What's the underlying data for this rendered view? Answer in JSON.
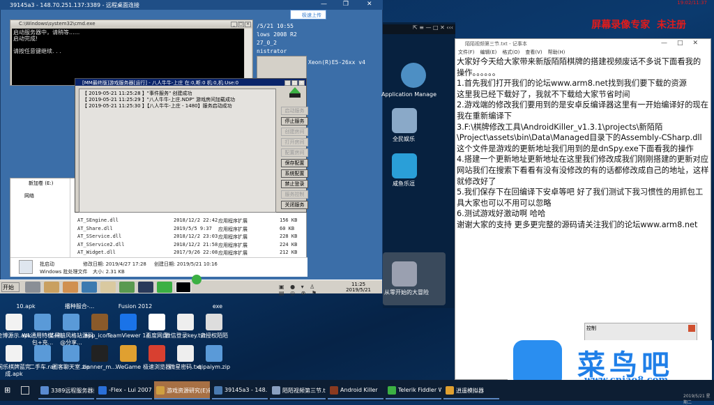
{
  "remote": {
    "title": "39145a3 - 148.70.251.137:3389 - 远程桌面连接",
    "upload": "极速上传",
    "sysinfo": [
      "/5/21 10:55",
      "lows 2008 R2",
      "27_0_2",
      "nistrator"
    ],
    "cpu": "Xeon(R)E5-26xx v4"
  },
  "cmd": {
    "title": "C:\\Windows\\system32\\cmd.exe",
    "lines": [
      "启动服务器中，请稍等......",
      "启动完成!",
      "",
      "请按任意键继续. . ."
    ]
  },
  "server": {
    "title": "[MM最终版]游戏服务器[运行] - 八人牛牛-上庄      在:0,断:0      机:0,机:Use:0",
    "log": [
      "【 2019-05-21 11:25:28 】\"事件服务\" 创建成功",
      "【 2019-05-21 11:25:29 】\"八人牛牛-上庄.NDP\" 游戏房间加载成功",
      "【 2019-05-21 11:25:30 】【八人牛牛-上庄 - 1480】服务启动成功"
    ],
    "buttons": [
      {
        "label": "启动服务",
        "enabled": false
      },
      {
        "label": "停止服务",
        "enabled": true
      },
      {
        "label": "创建房间",
        "enabled": false
      },
      {
        "label": "打开房间",
        "enabled": false
      },
      {
        "label": "配置房间",
        "enabled": false
      },
      {
        "label": "保存配置",
        "enabled": true
      },
      {
        "label": "系统配置",
        "enabled": true
      },
      {
        "label": "禁止登录",
        "enabled": true
      },
      {
        "label": "服务控制",
        "enabled": false
      },
      {
        "label": "关闭服务",
        "enabled": true
      }
    ]
  },
  "explorer": {
    "drive": "新加卷 (E:)",
    "network": "网络",
    "files": [
      {
        "name": "AT_SEngine.dll",
        "date": "2018/12/2 22:42",
        "type": "应用程序扩展",
        "size": "156 KB"
      },
      {
        "name": "AT_Share.dll",
        "date": "2019/5/5 9:37",
        "type": "应用程序扩展",
        "size": "60 KB"
      },
      {
        "name": "AT_SService.dll",
        "date": "2018/12/2 23:03",
        "type": "应用程序扩展",
        "size": "228 KB"
      },
      {
        "name": "AT_SService2.dll",
        "date": "2018/12/2 21:58",
        "type": "应用程序扩展",
        "size": "224 KB"
      },
      {
        "name": "AT_Widget.dll",
        "date": "2017/9/26 22:08",
        "type": "应用程序扩展",
        "size": "212 KB"
      }
    ],
    "detail": {
      "name": "批启动",
      "kind": "Windows 批处理文件",
      "modified": "修改日期: 2019/4/27 17:28",
      "created": "创建日期: 2019/5/21 10:16",
      "size": "大小: 2.31 KB"
    }
  },
  "inner_taskbar": {
    "start": "开始",
    "time": "11:25",
    "date": "2019/5/21"
  },
  "emulator": {
    "apps": [
      "Application Manage",
      "全民娱乐",
      "咸鱼乐逗",
      "从零开始的大冒险"
    ]
  },
  "recorder": {
    "watermark": "屏幕录像专家",
    "unregistered": "未注册",
    "time": "19:02/11:37"
  },
  "notepad": {
    "title": "陌陌视频第三节.txt - 记事本",
    "menu": [
      "文件(F)",
      "编辑(E)",
      "格式(O)",
      "查看(V)",
      "帮助(H)"
    ],
    "text": "大家好今天给大家带来新版陌陌棋牌的搭建视频废话不多说下面看我的 操作。。。。。。\n1.首先我们打开我们的论坛www.arm8.net找到我们要下载的资源\n这里我已经下载好了，我就不下载给大家节省时间\n2.游戏端的修改我们要用到的是安卓反编译器这里有一开始编译好的现在我在重新编译下\n3.F:\\棋牌修改工具\\AndroidKiller_v1.3.1\\projects\\新陌陌\\Project\\assets\\bin\\Data\\Managed目录下的Assembly-CSharp.dll这个文件是游戏的更新地址我们用到的是dnSpy.exe下面看我的操作\n4.搭建一个更新地址更新地址在这里我们修改成我们刚刚搭建的更新对应网站我们在搜索下看看有没有没修改的有的话都修改成自己的地址，这样就修改好了\n5.我们保存下在回编译下安卓等吧 好了我们测试下我习惯性的用抓包工具大家也可以不用可以忽略\n6.测试游戏好激动啊 哈哈\n谢谢大家的支持 更多更完整的源码请关注我们的论坛www.arm8.net"
  },
  "control": {
    "title": "控制"
  },
  "logo": {
    "name": "菜鸟吧",
    "url": "www.cniao8.com"
  },
  "desktop": {
    "top_labels": [
      "10.apk",
      "播种服合-...",
      "Fusion 2012",
      "exe"
    ],
    "row1": [
      {
        "label": "金博源示.apk",
        "color": "#f2f2f2"
      },
      {
        "label": "WL通用特权+礼包+充...",
        "color": "#5a9ad8"
      },
      {
        "label": "某黑暗风格站源码@分享...",
        "color": "#5a9ad8"
      },
      {
        "label": "app_icon...",
        "color": "#8a5a2a"
      },
      {
        "label": "TeamViewer 14",
        "color": "#1a73e8"
      },
      {
        "label": "百度网盘",
        "color": "#ffffff"
      },
      {
        "label": "微信登录key.txt",
        "color": "#eeeeee"
      },
      {
        "label": "去授权陌陌",
        "color": "#dddddd"
      }
    ],
    "row2": [
      {
        "label": "闲乐棋牌蓝完成.apk",
        "color": "#f2f2f2"
      },
      {
        "label": "二手车.rar",
        "color": "#5a9ad8"
      },
      {
        "label": "图客聊天室.zip",
        "color": "#5a9ad8"
      },
      {
        "label": "banner_m...",
        "color": "#222222"
      },
      {
        "label": "WeGame",
        "color": "#e0a030"
      },
      {
        "label": "极速浏览器",
        "color": "#d84030"
      },
      {
        "label": "微星密码.txt",
        "color": "#eeeeee"
      },
      {
        "label": "qipaiym.zip",
        "color": "#5a9ad8"
      }
    ]
  },
  "taskbar": {
    "items": [
      {
        "label": "3389远程服务器批...",
        "active": false
      },
      {
        "label": "-Flex - Lui 2007 (S...",
        "active": false
      },
      {
        "label": "游戏资源研究(E)新...",
        "active": true
      },
      {
        "label": "39145a3 - 148.70....",
        "active": false
      },
      {
        "label": "陌陌视频第三节.txt...",
        "active": false
      },
      {
        "label": "Android Killer",
        "active": false
      },
      {
        "label": "Telerik Fiddler W...",
        "active": false
      },
      {
        "label": "逍遥模拟器",
        "active": false
      }
    ],
    "date": "2019/5/21 星期二"
  }
}
